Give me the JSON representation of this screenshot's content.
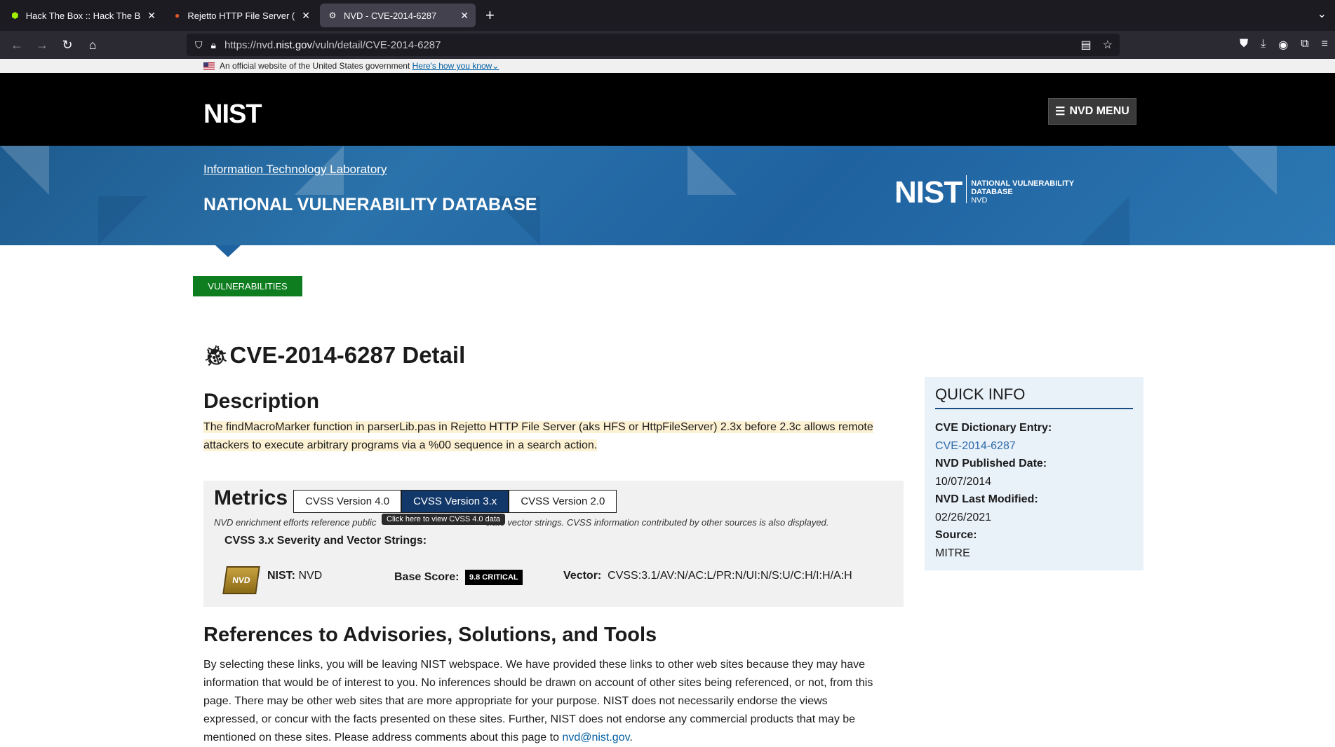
{
  "browser": {
    "tabs": [
      {
        "title": "Hack The Box :: Hack The Box",
        "icon": "htb-cube-icon",
        "active": false
      },
      {
        "title": "Rejetto HTTP File Server (HFS)",
        "icon": "rejetto-icon",
        "active": false
      },
      {
        "title": "NVD - CVE-2014-6287",
        "icon": "nvd-icon",
        "active": true
      }
    ],
    "url_prefix": "https://nvd.",
    "url_domain": "nist.gov",
    "url_path": "/vuln/detail/CVE-2014-6287"
  },
  "gov_banner": {
    "text": "An official website of the United States government",
    "link": "Here's how you know"
  },
  "header": {
    "logo": "NIST",
    "menu_label": "NVD MENU"
  },
  "banner": {
    "itl_link": "Information Technology Laboratory",
    "title": "NATIONAL VULNERABILITY DATABASE",
    "logo_big": "NIST",
    "logo_line1": "NATIONAL VULNERABILITY",
    "logo_line2": "DATABASE",
    "logo_line3": "NVD"
  },
  "breadcrumb_button": "VULNERABILITIES",
  "cve_title": "CVE-2014-6287 Detail",
  "description": {
    "heading": "Description",
    "text": "The findMacroMarker function in parserLib.pas in Rejetto HTTP File Server (aks HFS or HttpFileServer) 2.3x before 2.3c allows remote attackers to execute arbitrary programs via a %00 sequence in a search action."
  },
  "metrics": {
    "heading": "Metrics",
    "tabs": [
      "CVSS Version 4.0",
      "CVSS Version 3.x",
      "CVSS Version 2.0"
    ],
    "selected_tab": "CVSS Version 3.x",
    "tooltip": "Click here to view CVSS 4.0 data",
    "note": "NVD enrichment efforts reference publicly available information to associate vector strings. CVSS information contributed by other sources is also displayed.",
    "note_left": "NVD enrichment efforts reference public",
    "note_right": "ciate vector strings. CVSS information contributed by other sources is also displayed.",
    "severity_heading": "CVSS 3.x Severity and Vector Strings:",
    "badge": "NVD",
    "cna_label": "NIST:",
    "cna_value": "NVD",
    "base_score_label": "Base Score:",
    "base_score_value": "9.8 CRITICAL",
    "vector_label": "Vector:",
    "vector_value": "CVSS:3.1/AV:N/AC:L/PR:N/UI:N/S:U/C:H/I:H/A:H"
  },
  "references": {
    "heading": "References to Advisories, Solutions, and Tools",
    "text": "By selecting these links, you will be leaving NIST webspace. We have provided these links to other web sites because they may have information that would be of interest to you. No inferences should be drawn on account of other sites being referenced, or not, from this page. There may be other web sites that are more appropriate for your purpose. NIST does not necessarily endorse the views expressed, or concur with the facts presented on these sites. Further, NIST does not endorse any commercial products that may be mentioned on these sites. Please address comments about this page to ",
    "email": "nvd@nist.gov",
    "tail": "."
  },
  "quick_info": {
    "title": "QUICK INFO",
    "dict_label": "CVE Dictionary Entry:",
    "dict_value": "CVE-2014-6287",
    "published_label": "NVD Published Date:",
    "published_value": "10/07/2014",
    "modified_label": "NVD Last Modified:",
    "modified_value": "02/26/2021",
    "source_label": "Source:",
    "source_value": "MITRE"
  },
  "colors": {
    "header_bg": "#000000",
    "banner_blue": "#1f62a0",
    "vuln_green": "#0e7d1f",
    "tab_selected": "#12386a",
    "highlight": "#fdf1d3"
  }
}
